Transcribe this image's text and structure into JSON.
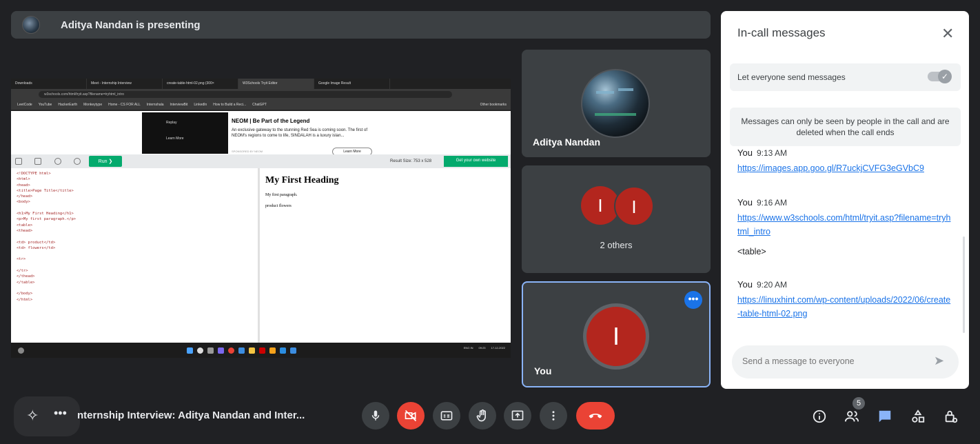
{
  "presenting": {
    "text": "Aditya Nandan is presenting"
  },
  "shared_screen": {
    "tabs": [
      "Downloads",
      "Meet - Internship Interview",
      "create-table-html-02.png (300×",
      "W3Schools Tryit Editor",
      "Google Image Result"
    ],
    "url": "w3schools.com/html/tryit.asp?filename=tryhtml_intro",
    "bookmarks": [
      "LeetCode",
      "YouTube",
      "HackerEarth",
      "Monkeytype",
      "Home - CS FOR ALL",
      "Internshala",
      "InterviewBit",
      "LinkedIn",
      "How to Build a Reci...",
      "ChatGPT",
      "Other bookmarks"
    ],
    "ad": {
      "title": "NEOM | Be Part of the Legend",
      "body": "An exclusive gateway to the stunning Red Sea is coming soon. The first of NEOM's regions to come to life, SINDALAH is a luxury islan...",
      "sponsor": "SPONSORED BY NEOM",
      "button": "Learn More",
      "replay": "Replay",
      "learn": "Learn More"
    },
    "run_label": "Run ❯",
    "result_size": "Result Size: 753 x 528",
    "get_site": "Get your own website",
    "code": "<!DOCTYPE html>\n<html>\n<head>\n<title>Page Title</title>\n</head>\n<body>\n\n<h1>My First Heading</h1>\n<p>My first paragraph.</p>\n<table>\n<thead>\n\n<td> product</td>\n<td> flowers</td>\n\n<tr>\n\n</tr>\n</thead>\n</table>\n\n</body>\n</html>",
    "result_heading": "My First Heading",
    "result_p1": "My first paragraph.",
    "result_p2": "product flowers",
    "tray_lang": "ENG IN",
    "tray_time": "09:23",
    "tray_date": "17-12-2022"
  },
  "tiles": {
    "aditya_name": "Aditya Nandan",
    "others_initial_a": "I",
    "others_initial_b": "I",
    "others_label": "2 others",
    "you_initial": "I",
    "you_name": "You",
    "more_label": "•••"
  },
  "chat": {
    "title": "In-call messages",
    "close_icon": "✕",
    "toggle_label": "Let everyone send messages",
    "toggle_on": true,
    "notice": "Messages can only be seen by people in the call and are deleted when the call ends",
    "messages": [
      {
        "sender": "You",
        "time": "9:13 AM",
        "link": "https://images.app.goo.gl/R7uckjCVFG3eGVbC9"
      },
      {
        "sender": "You",
        "time": "9:16 AM",
        "link": "https://www.w3schools.com/html/tryit.asp?filename=tryhtml_intro",
        "text": "<table>"
      },
      {
        "sender": "You",
        "time": "9:20 AM",
        "link": "https://linuxhint.com/wp-content/uploads/2022/06/create-table-html-02.png"
      }
    ],
    "input_placeholder": "Send a message to everyone",
    "send_icon": "➤"
  },
  "bottom_bar": {
    "meeting_title": "nternship Interview: Aditya Nandan and Inter...",
    "more_dots": "•••",
    "people_count": "5"
  },
  "colors": {
    "background": "#202124",
    "hangup_red": "#ea4335",
    "accent_blue": "#1a73e8",
    "avatar_red": "#b3261e",
    "run_green": "#04aa6d"
  },
  "icons": [
    "mic-icon",
    "camera-off-icon",
    "captions-icon",
    "raise-hand-icon",
    "present-screen-icon",
    "more-options-icon",
    "hangup-icon",
    "info-icon",
    "people-icon",
    "chat-icon",
    "activities-icon",
    "host-controls-icon"
  ]
}
